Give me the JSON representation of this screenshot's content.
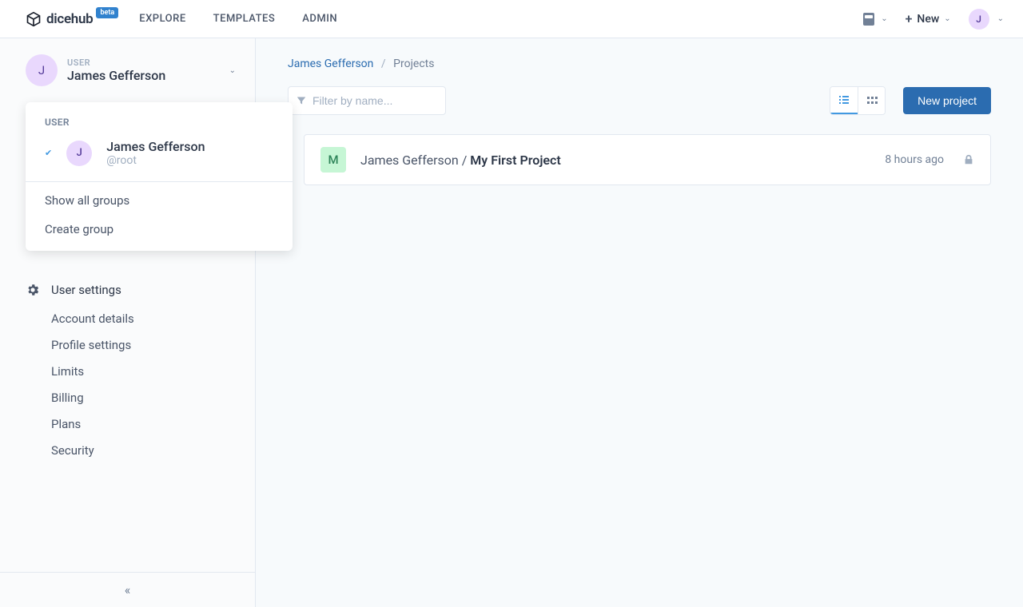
{
  "brand": {
    "name": "dicehub",
    "badge": "beta"
  },
  "topnav": {
    "explore": "EXPLORE",
    "templates": "TEMPLATES",
    "admin": "ADMIN"
  },
  "top_right": {
    "new_label": "New",
    "avatar_initial": "J"
  },
  "sidebar": {
    "user_label": "USER",
    "user_name": "James Gefferson",
    "user_initial": "J",
    "settings_header": "User settings",
    "items": {
      "account": "Account details",
      "profile": "Profile settings",
      "limits": "Limits",
      "billing": "Billing",
      "plans": "Plans",
      "security": "Security"
    }
  },
  "dropdown": {
    "label": "USER",
    "user_name": "James Gefferson",
    "user_handle": "@root",
    "user_initial": "J",
    "show_all": "Show all groups",
    "create": "Create group"
  },
  "breadcrumb": {
    "user": "James Gefferson",
    "page": "Projects"
  },
  "toolbar": {
    "filter_placeholder": "Filter by name...",
    "new_project": "New project"
  },
  "project": {
    "avatar_initial": "M",
    "owner": "James Gefferson",
    "name": "My First Project",
    "time": "8 hours ago"
  }
}
